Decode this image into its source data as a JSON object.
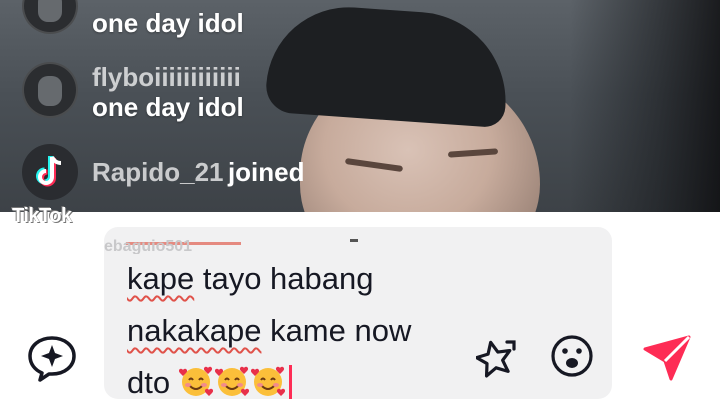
{
  "chat": {
    "messages": [
      {
        "username": "",
        "text": "one day idol"
      },
      {
        "username": "flyboiiiiiiiiiiii",
        "text": "one day idol"
      }
    ],
    "join_event": {
      "username": "Rapido_21",
      "action": "joined"
    }
  },
  "watermark": "TikTok",
  "composer": {
    "ghost_mention": "ebaguio501",
    "text_parts": [
      "kape",
      " tayo habang ",
      "nakakape",
      " kame now dto "
    ],
    "emoji_count": 3
  },
  "icons": {
    "ai_assist": "sparkle-chat-icon",
    "sticker": "star-sticker-icon",
    "emoji": "smiley-icon",
    "send": "send-arrow-icon"
  },
  "colors": {
    "accent": "#fe2c55",
    "composer_bg": "#f1f1f2",
    "text": "#161823"
  }
}
